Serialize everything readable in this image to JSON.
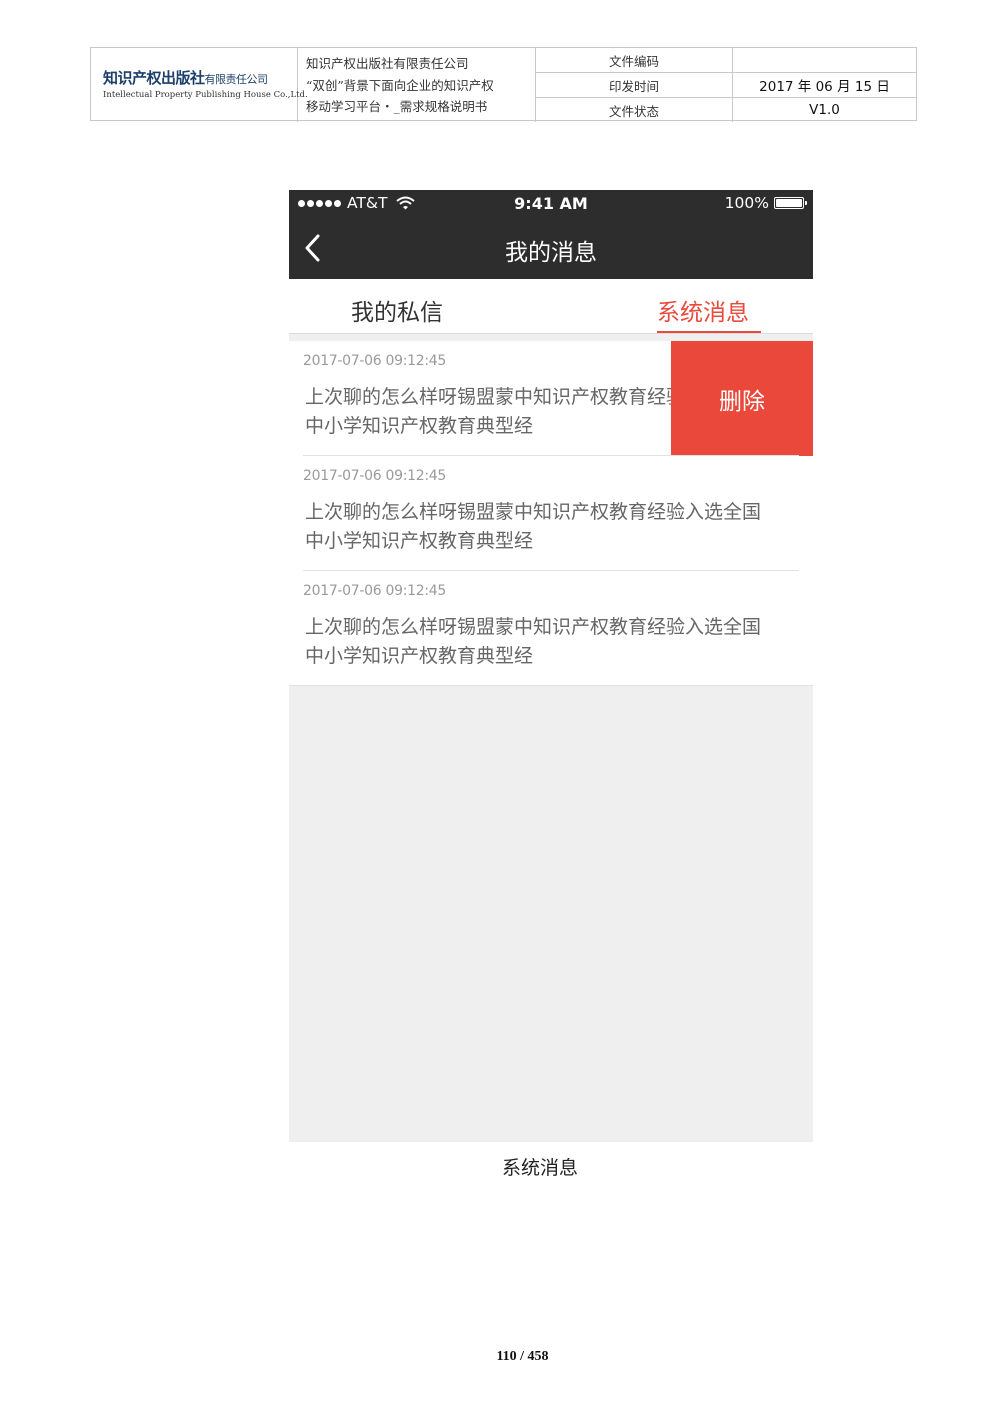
{
  "header": {
    "logo": {
      "name_cn": "知识产权出版社",
      "suffix_cn": "有限责任公司",
      "name_en": "Intellectual Property Publishing House Co.,Ltd."
    },
    "company": "知识产权出版社有限责任公司",
    "doc_title_line1": "“双创”背景下面向企业的知识产权",
    "doc_title_line2": "移动学习平台・_需求规格说明书",
    "labels": {
      "code": "文件编码",
      "issue_date": "印发时间",
      "status": "文件状态"
    },
    "values": {
      "code": "",
      "issue_date": "2017 年 06 月 15 日",
      "status": "V1.0"
    }
  },
  "phone": {
    "status_bar": {
      "carrier": "AT&T",
      "time": "9:41 AM",
      "battery": "100%"
    },
    "battery_level": 1.0,
    "nav_title": "我的消息",
    "tabs": {
      "private": "我的私信",
      "system": "系统消息",
      "active": "system"
    },
    "accent_color": "#e9483b",
    "delete_label": "删除",
    "messages": [
      {
        "time": "2017-07-06 09:12:45",
        "line1": "上次聊的怎么样呀锡盟蒙中知识产权教育经验入选全国",
        "line2": "中小学知识产权教育典型经",
        "swiped": true
      },
      {
        "time": "2017-07-06 09:12:45",
        "line1": "上次聊的怎么样呀锡盟蒙中知识产权教育经验入选全国",
        "line2": "中小学知识产权教育典型经",
        "swiped": false
      },
      {
        "time": "2017-07-06 09:12:45",
        "line1": "上次聊的怎么样呀锡盟蒙中知识产权教育经验入选全国",
        "line2": "中小学知识产权教育典型经",
        "swiped": false
      }
    ]
  },
  "caption": "系统消息",
  "page_number": "110 / 458"
}
